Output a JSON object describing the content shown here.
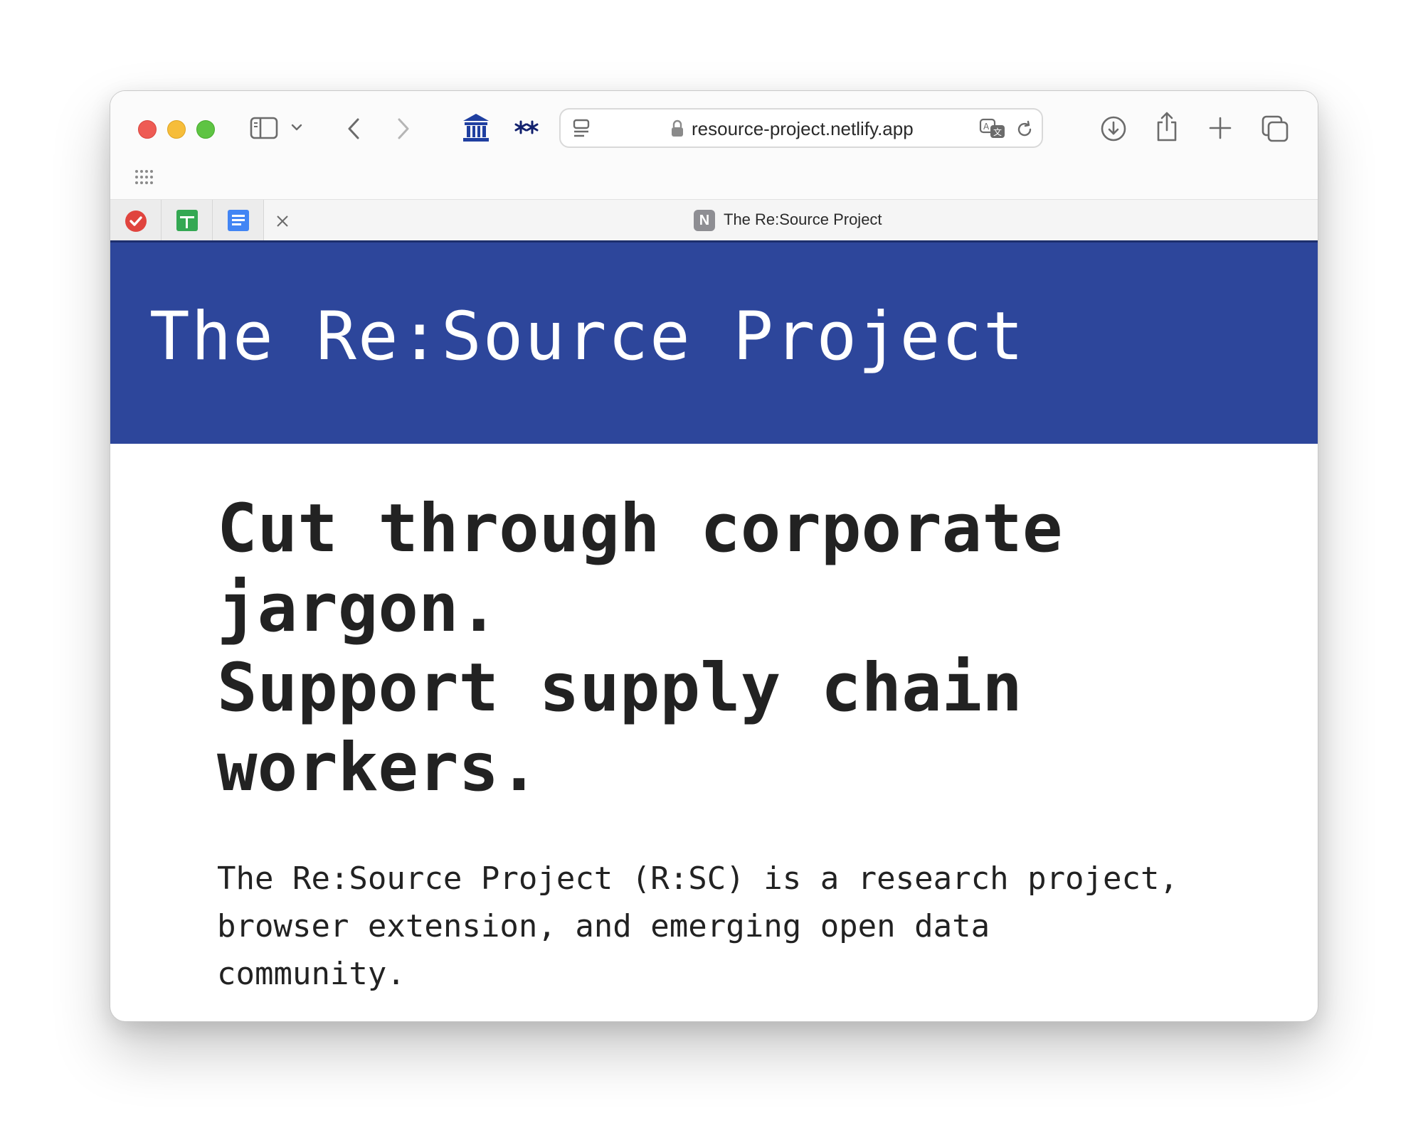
{
  "browser": {
    "url": "resource-project.netlify.app",
    "tab_title": "The Re:Source Project",
    "tab_badge": "N",
    "icons": [
      "sidebar-icon",
      "chevron-down-icon",
      "back-icon",
      "forward-icon",
      "museum-icon",
      "stars-icon",
      "reader-icon",
      "lock-icon",
      "translate-icon",
      "reload-icon",
      "download-icon",
      "share-icon",
      "new-tab-icon",
      "tabs-overview-icon",
      "grid-icon",
      "close-icon"
    ],
    "pinned_tabs": [
      "todoist-icon",
      "sheets-icon",
      "docs-icon"
    ],
    "colors": {
      "hero_bg": "#2d469b",
      "text": "#222222",
      "close_red": "#ee5b54",
      "minimize_yellow": "#f6bd3a",
      "zoom_green": "#5ec443"
    }
  },
  "page": {
    "site_title": "The Re:Source Project",
    "headline_lines": [
      "Cut through corporate",
      "jargon.",
      "Support supply chain",
      "workers."
    ],
    "body_lines": [
      "The Re:Source Project (R:SC) is a research project,",
      "browser extension, and emerging open data",
      "community."
    ]
  }
}
